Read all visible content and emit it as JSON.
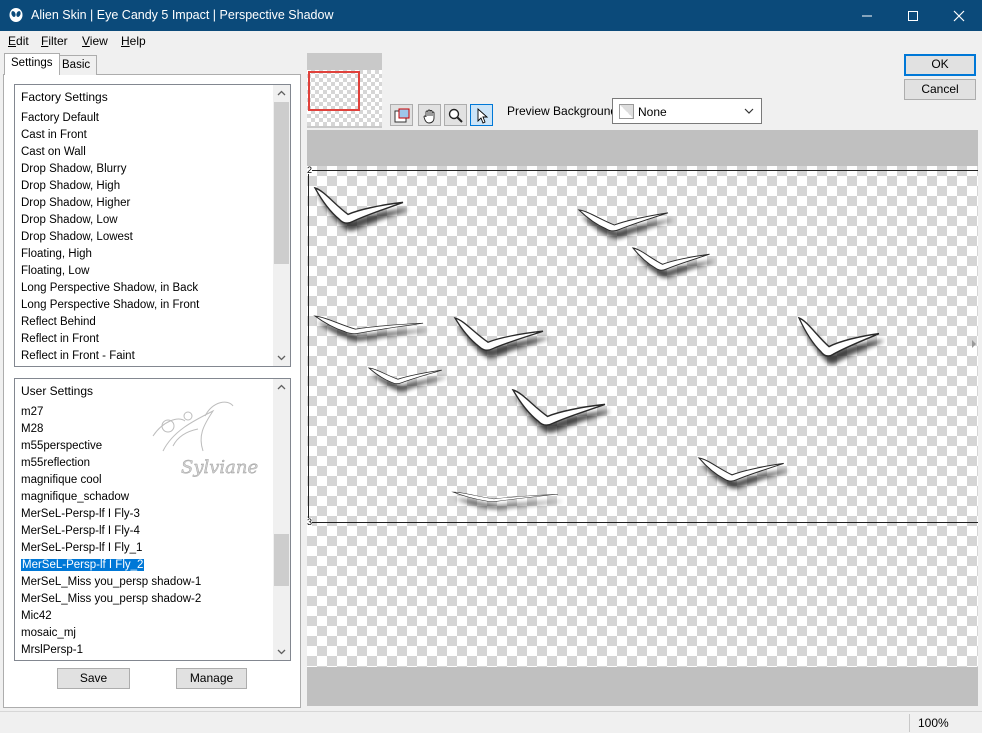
{
  "window": {
    "title": "Alien Skin | Eye Candy 5 Impact | Perspective Shadow",
    "icon": "alien-skin-icon",
    "title_bar_color": "#0b4a7a"
  },
  "menu": [
    "Edit",
    "Filter",
    "View",
    "Help"
  ],
  "tabs": [
    "Settings",
    "Basic"
  ],
  "factory_settings": {
    "header": "Factory Settings",
    "items": [
      "Factory Default",
      "Cast in Front",
      "Cast on Wall",
      "Drop Shadow, Blurry",
      "Drop Shadow, High",
      "Drop Shadow, Higher",
      "Drop Shadow, Low",
      "Drop Shadow, Lowest",
      "Floating, High",
      "Floating, Low",
      "Long Perspective Shadow, in Back",
      "Long Perspective Shadow, in Front",
      "Reflect Behind",
      "Reflect in Front",
      "Reflect in Front - Faint"
    ]
  },
  "user_settings": {
    "header": "User Settings",
    "items": [
      "m27",
      "M28",
      "m55perspective",
      "m55reflection",
      "magnifique cool",
      "magnifique_schadow",
      "MerSeL-Persp-lf I Fly-3",
      "MerSeL-Persp-lf I Fly-4",
      "MerSeL-Persp-lf I Fly_1",
      "MerSeL-Persp-lf I Fly_2",
      "MerSeL_Miss you_persp shadow-1",
      "MerSeL_Miss you_persp shadow-2",
      "Mic42",
      "mosaic_mj",
      "MrslPersp-1"
    ],
    "selected": "MerSeL-Persp-lf I Fly_2",
    "watermark": "Sylviane"
  },
  "buttons": {
    "save": "Save",
    "manage": "Manage",
    "ok": "OK",
    "cancel": "Cancel"
  },
  "toolbar": {
    "tools": [
      "navigator-icon",
      "hand-icon",
      "zoom-icon",
      "pointer-icon"
    ],
    "active_tool": "pointer-icon"
  },
  "preview_background": {
    "label": "Preview Background:",
    "value": "None"
  },
  "status": {
    "zoom": "100%"
  },
  "colors": {
    "selection": "#0078d7",
    "thumbnail_marker": "#e0413b"
  }
}
